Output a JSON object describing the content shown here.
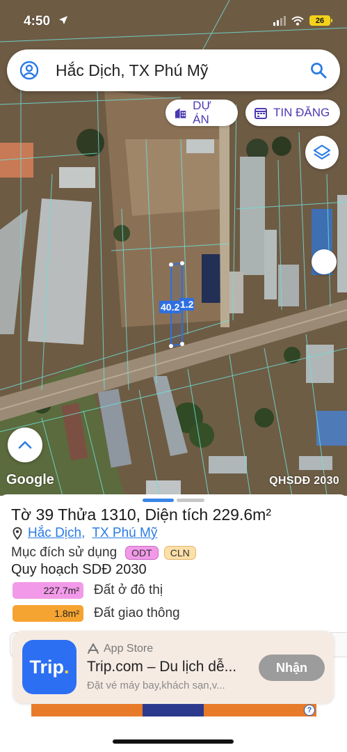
{
  "status_bar": {
    "time": "4:50",
    "battery": "26"
  },
  "search": {
    "query": "Hắc Dịch, TX Phú Mỹ"
  },
  "chips": {
    "project": "DỰ ÁN",
    "listing": "TIN ĐĂNG"
  },
  "map": {
    "parcel_length": "40.2",
    "parcel_width": "1.2",
    "attribution": "Google",
    "overlay_name": "QHSDĐ 2030"
  },
  "parcel": {
    "title": "Tờ 39 Thửa 1310, Diện tích 229.6m²",
    "ward": "Hắc Dịch",
    "separator": ",",
    "town": "TX Phú Mỹ",
    "usage_label": "Mục đích sử dụng",
    "usage_tags": [
      "ODT",
      "CLN"
    ],
    "plan_heading": "Quy hoạch SDĐ 2030",
    "plan_items": [
      {
        "area": "227.7m²",
        "label": "Đất ở đô thị",
        "color": "#f29ae9"
      },
      {
        "area": "1.8m²",
        "label": "Đất giao thông",
        "color": "#f5a431"
      }
    ]
  },
  "ad": {
    "logo_text": "Trip",
    "logo_dot": ".",
    "store": "App Store",
    "title": "Trip.com – Du lịch dễ...",
    "subtitle": "Đặt vé máy bay,khách sạn,v...",
    "button": "Nhận"
  },
  "colors": {
    "accent": "#2a7be4",
    "chip_text": "#4a3ab2",
    "odt": "#f29ae9",
    "cln": "#fce0a8"
  }
}
